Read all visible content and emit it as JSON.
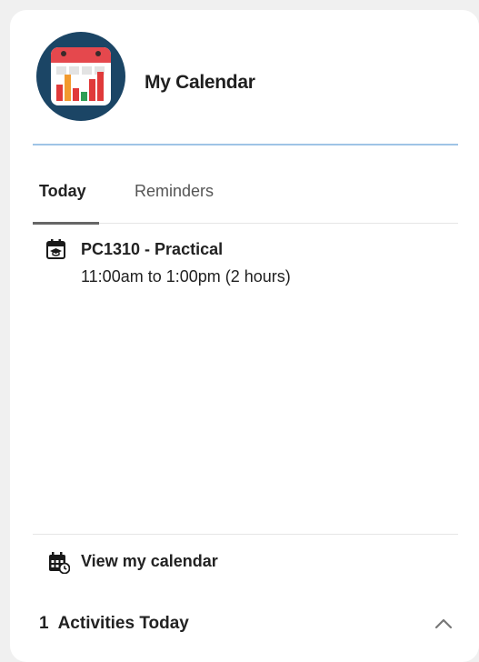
{
  "widget": {
    "title": "My Calendar",
    "logo_icon": "calendar-chart-icon",
    "accent_color": "#9fc4e6",
    "logo_bg_color": "#1b4565"
  },
  "tabs": [
    {
      "label": "Today",
      "active": true
    },
    {
      "label": "Reminders",
      "active": false
    }
  ],
  "events": [
    {
      "icon": "lecture-calendar-icon",
      "title": "PC1310 - Practical",
      "time": "11:00am to 1:00pm (2 hours)"
    }
  ],
  "footer": {
    "view_calendar_label": "View my calendar",
    "view_calendar_icon": "calendar-clock-icon",
    "activities_count": "1",
    "activities_label": "Activities Today",
    "collapse_icon": "chevron-up-icon"
  }
}
